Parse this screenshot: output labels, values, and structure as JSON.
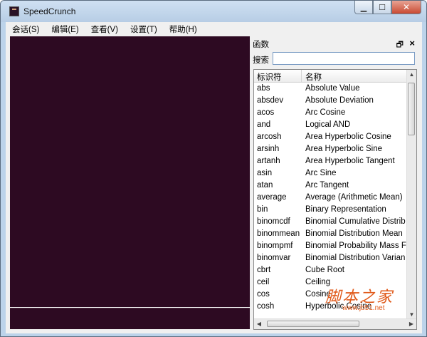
{
  "window": {
    "title": "SpeedCrunch"
  },
  "menu": [
    "会话(S)",
    "编辑(E)",
    "查看(V)",
    "设置(T)",
    "帮助(H)"
  ],
  "dock": {
    "title": "函数",
    "search_label": "搜索",
    "search_value": "",
    "headers": {
      "id": "标识符",
      "name": "名称"
    },
    "rows": [
      {
        "id": "abs",
        "name": "Absolute Value"
      },
      {
        "id": "absdev",
        "name": "Absolute Deviation"
      },
      {
        "id": "acos",
        "name": "Arc Cosine"
      },
      {
        "id": "and",
        "name": "Logical AND"
      },
      {
        "id": "arcosh",
        "name": "Area Hyperbolic Cosine"
      },
      {
        "id": "arsinh",
        "name": "Area Hyperbolic Sine"
      },
      {
        "id": "artanh",
        "name": "Area Hyperbolic Tangent"
      },
      {
        "id": "asin",
        "name": "Arc Sine"
      },
      {
        "id": "atan",
        "name": "Arc Tangent"
      },
      {
        "id": "average",
        "name": "Average (Arithmetic Mean)"
      },
      {
        "id": "bin",
        "name": "Binary Representation"
      },
      {
        "id": "binomcdf",
        "name": "Binomial Cumulative Distrib"
      },
      {
        "id": "binommean",
        "name": "Binomial Distribution Mean"
      },
      {
        "id": "binompmf",
        "name": "Binomial Probability Mass F"
      },
      {
        "id": "binomvar",
        "name": "Binomial Distribution Varian"
      },
      {
        "id": "cbrt",
        "name": "Cube Root"
      },
      {
        "id": "ceil",
        "name": "Ceiling"
      },
      {
        "id": "cos",
        "name": "Cosine"
      },
      {
        "id": "cosh",
        "name": "Hyperbolic Cosine"
      }
    ]
  },
  "watermark": {
    "text": "脚本之家",
    "url": "www.jb51.net"
  },
  "colors": {
    "display_bg": "#2d0a22",
    "titlebar": "#bcd3ea"
  }
}
